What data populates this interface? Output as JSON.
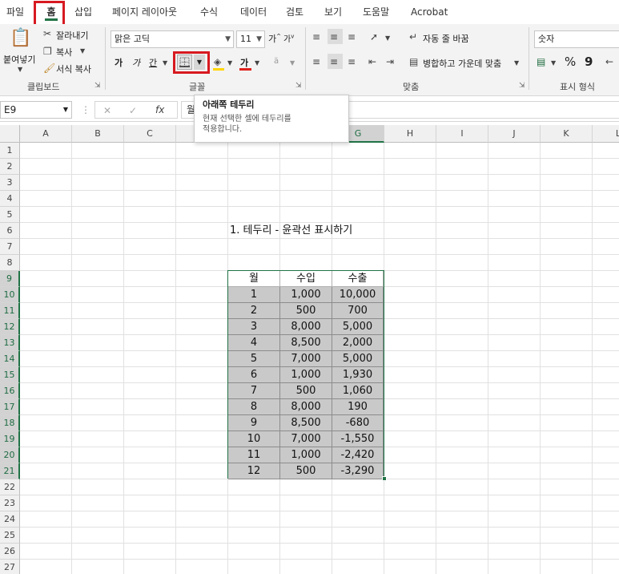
{
  "ribbon_tabs": [
    "파일",
    "홈",
    "삽입",
    "페이지 레이아웃",
    "수식",
    "데이터",
    "검토",
    "보기",
    "도움말",
    "Acrobat"
  ],
  "clipboard": {
    "paste": "붙여넣기",
    "cut": "잘라내기",
    "copy": "복사",
    "format_painter": "서식 복사",
    "group": "클립보드"
  },
  "font": {
    "name": "맑은 고딕",
    "size": "11",
    "group": "글꼴",
    "bold": "가",
    "italic": "가",
    "underline": "간",
    "font_color_glyph": "가",
    "grow_glyph": "가",
    "shrink_glyph": "가"
  },
  "alignment": {
    "wrap": "자동 줄 바꿈",
    "merge": "병합하고 가운데 맞춤",
    "group": "맞춤"
  },
  "number": {
    "format": "숫자",
    "group": "표시 형식",
    "percent": "%",
    "comma": "9"
  },
  "formula_bar": {
    "name_box": "E9",
    "fx": "fx",
    "content": "월"
  },
  "tooltip": {
    "title": "아래쪽 테두리",
    "description": "현재 선택한 셀에 테두리를\n적용합니다."
  },
  "sheet": {
    "columns": [
      "A",
      "B",
      "C",
      "D",
      "E",
      "F",
      "G",
      "H",
      "I",
      "J",
      "K",
      "L"
    ],
    "selected_columns": [
      "E",
      "F",
      "G"
    ],
    "rows": [
      "1",
      "2",
      "3",
      "4",
      "5",
      "6",
      "7",
      "8",
      "9",
      "10",
      "11",
      "12",
      "13",
      "14",
      "15",
      "16",
      "17",
      "18",
      "19",
      "20",
      "21",
      "22",
      "23",
      "24",
      "25",
      "26",
      "27"
    ],
    "selected_row_range": [
      9,
      21
    ],
    "caption": "1. 테두리 - 윤곽선 표시하기"
  },
  "table": {
    "headers": [
      "월",
      "수입",
      "수출"
    ],
    "rows": [
      [
        "1",
        "1,000",
        "10,000"
      ],
      [
        "2",
        "500",
        "700"
      ],
      [
        "3",
        "8,000",
        "5,000"
      ],
      [
        "4",
        "8,500",
        "2,000"
      ],
      [
        "5",
        "7,000",
        "5,000"
      ],
      [
        "6",
        "1,000",
        "1,930"
      ],
      [
        "7",
        "500",
        "1,060"
      ],
      [
        "8",
        "8,000",
        "190"
      ],
      [
        "9",
        "8,500",
        "-680"
      ],
      [
        "10",
        "7,000",
        "-1,550"
      ],
      [
        "11",
        "1,000",
        "-2,420"
      ],
      [
        "12",
        "500",
        "-3,290"
      ]
    ]
  },
  "colors": {
    "accent": "#217346",
    "highlight_box": "#d71920",
    "table_fill": "#c9c9c9"
  }
}
